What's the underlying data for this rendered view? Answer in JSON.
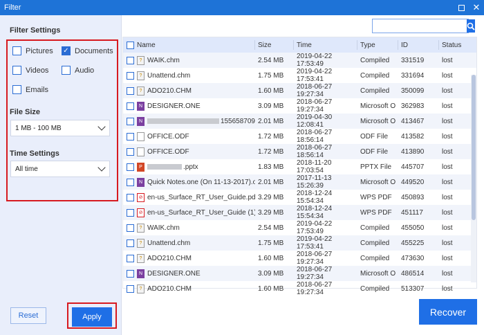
{
  "window": {
    "title": "Filter"
  },
  "filter": {
    "heading": "Filter Settings",
    "types": [
      {
        "label": "Pictures",
        "checked": false
      },
      {
        "label": "Documents",
        "checked": true
      },
      {
        "label": "Videos",
        "checked": false
      },
      {
        "label": "Audio",
        "checked": false
      },
      {
        "label": "Emails",
        "checked": false
      }
    ],
    "file_size_heading": "File Size",
    "file_size_value": "1 MB - 100 MB",
    "time_heading": "Time Settings",
    "time_value": "All time"
  },
  "buttons": {
    "reset": "Reset",
    "apply": "Apply",
    "recover": "Recover"
  },
  "search": {
    "placeholder": ""
  },
  "table": {
    "columns": [
      "Name",
      "Size",
      "Time",
      "Type",
      "ID",
      "Status"
    ],
    "rows": [
      {
        "icon": "chm-icon",
        "name": "WAIK.chm",
        "size": "2.54 MB",
        "time": "2019-04-22 17:53:49",
        "type": "Compiled",
        "id": "331519",
        "status": "lost"
      },
      {
        "icon": "chm-icon",
        "name": "Unattend.chm",
        "size": "1.75 MB",
        "time": "2019-04-22 17:53:41",
        "type": "Compiled",
        "id": "331694",
        "status": "lost"
      },
      {
        "icon": "chm-icon",
        "name": "ADO210.CHM",
        "size": "1.60 MB",
        "time": "2018-06-27 19:27:34",
        "type": "Compiled",
        "id": "350099",
        "status": "lost"
      },
      {
        "icon": "onenote-icon",
        "name": "DESIGNER.ONE",
        "size": "3.09 MB",
        "time": "2018-06-27 19:27:34",
        "type": "Microsoft O",
        "id": "362983",
        "status": "lost"
      },
      {
        "icon": "onenote-icon",
        "name": "155658709",
        "size": "2.01 MB",
        "time": "2019-04-30 12:08:41",
        "type": "Microsoft O",
        "id": "413467",
        "status": "lost"
      },
      {
        "icon": "doc-icon",
        "name": "OFFICE.ODF",
        "size": "1.72 MB",
        "time": "2018-06-27 18:56:14",
        "type": "ODF File",
        "id": "413582",
        "status": "lost"
      },
      {
        "icon": "doc-icon",
        "name": "OFFICE.ODF",
        "size": "1.72 MB",
        "time": "2018-06-27 18:56:14",
        "type": "ODF File",
        "id": "413890",
        "status": "lost"
      },
      {
        "icon": "pptx-icon",
        "name": ".pptx",
        "size": "1.83 MB",
        "time": "2018-11-20 17:03:54",
        "type": "PPTX File",
        "id": "445707",
        "status": "lost"
      },
      {
        "icon": "onenote-icon",
        "name": "Quick Notes.one (On 11-13-2017).one",
        "size": "2.01 MB",
        "time": "2017-11-13 15:26:39",
        "type": "Microsoft O",
        "id": "449520",
        "status": "lost"
      },
      {
        "icon": "pdf-icon",
        "name": "en-us_Surface_RT_User_Guide.pdf",
        "size": "3.29 MB",
        "time": "2018-12-24 15:54:34",
        "type": "WPS PDF",
        "id": "450893",
        "status": "lost"
      },
      {
        "icon": "pdf-icon",
        "name": "en-us_Surface_RT_User_Guide (1).pdf",
        "size": "3.29 MB",
        "time": "2018-12-24 15:54:34",
        "type": "WPS PDF",
        "id": "451117",
        "status": "lost"
      },
      {
        "icon": "chm-icon",
        "name": "WAIK.chm",
        "size": "2.54 MB",
        "time": "2019-04-22 17:53:49",
        "type": "Compiled",
        "id": "455050",
        "status": "lost"
      },
      {
        "icon": "chm-icon",
        "name": "Unattend.chm",
        "size": "1.75 MB",
        "time": "2019-04-22 17:53:41",
        "type": "Compiled",
        "id": "455225",
        "status": "lost"
      },
      {
        "icon": "chm-icon",
        "name": "ADO210.CHM",
        "size": "1.60 MB",
        "time": "2018-06-27 19:27:34",
        "type": "Compiled",
        "id": "473630",
        "status": "lost"
      },
      {
        "icon": "onenote-icon",
        "name": "DESIGNER.ONE",
        "size": "3.09 MB",
        "time": "2018-06-27 19:27:34",
        "type": "Microsoft O",
        "id": "486514",
        "status": "lost"
      },
      {
        "icon": "chm-icon",
        "name": "ADO210.CHM",
        "size": "1.60 MB",
        "time": "2018-06-27 19:27:34",
        "type": "Compiled",
        "id": "513307",
        "status": "lost"
      }
    ]
  },
  "colors": {
    "accent": "#1f6fe6",
    "titlebar": "#1e73d7",
    "highlight": "#d7191f"
  }
}
